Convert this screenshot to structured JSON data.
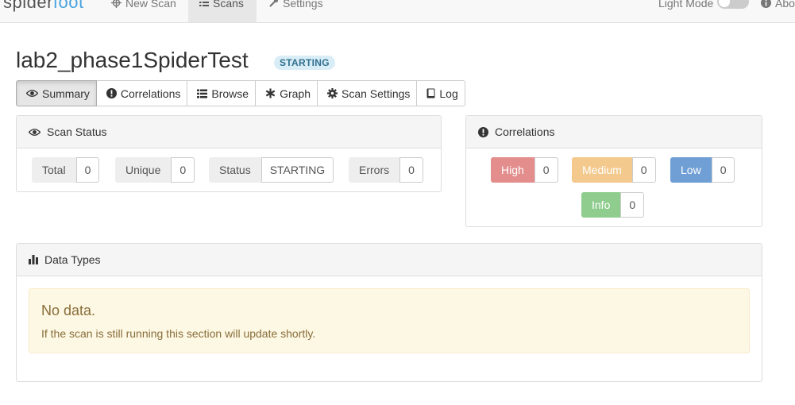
{
  "nav": {
    "brand_left": "spider",
    "brand_right": "foot",
    "items": [
      {
        "label": "New Scan",
        "icon": "crosshair-icon"
      },
      {
        "label": "Scans",
        "icon": "list-icon"
      },
      {
        "label": "Settings",
        "icon": "wrench-icon"
      }
    ],
    "light_mode_label": "Light Mode",
    "about_label": "About"
  },
  "scan": {
    "name": "lab2_phase1SpiderTest",
    "status_badge": "STARTING"
  },
  "tabs": [
    {
      "label": "Summary",
      "icon": "eye-icon"
    },
    {
      "label": "Correlations",
      "icon": "exclamation-circle-icon"
    },
    {
      "label": "Browse",
      "icon": "list-icon"
    },
    {
      "label": "Graph",
      "icon": "asterisk-icon"
    },
    {
      "label": "Scan Settings",
      "icon": "gear-icon"
    },
    {
      "label": "Log",
      "icon": "book-icon"
    }
  ],
  "scan_status": {
    "title": "Scan Status",
    "items": [
      {
        "label": "Total",
        "value": "0"
      },
      {
        "label": "Unique",
        "value": "0"
      },
      {
        "label": "Status",
        "value": "STARTING"
      },
      {
        "label": "Errors",
        "value": "0"
      }
    ]
  },
  "correlations": {
    "title": "Correlations",
    "items": [
      {
        "label": "High",
        "value": "0",
        "color": "#e38d8d"
      },
      {
        "label": "Medium",
        "value": "0",
        "color": "#f4c98d"
      },
      {
        "label": "Low",
        "value": "0",
        "color": "#6f9fd4"
      },
      {
        "label": "Info",
        "value": "0",
        "color": "#8fcd8f"
      }
    ]
  },
  "data_types": {
    "title": "Data Types",
    "alert_heading": "No data.",
    "alert_text": "If the scan is still running this section will update shortly."
  }
}
